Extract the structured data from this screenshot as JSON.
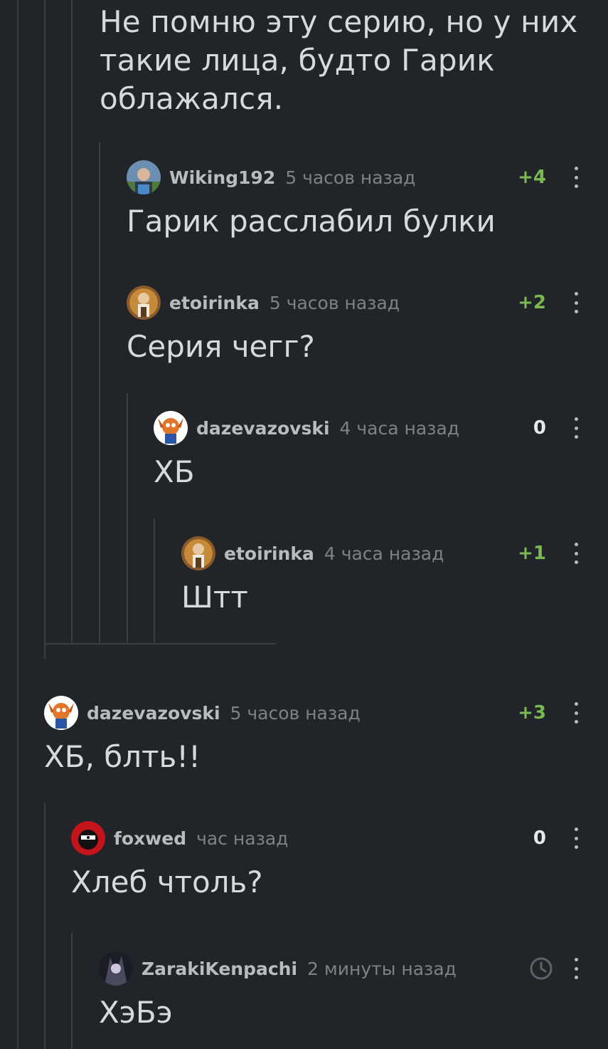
{
  "parent_comment_text": "Не помню эту серию, но у них такие лица, будто Гарик облажался.",
  "comments": [
    {
      "username": "Wiking192",
      "time": "5 часов назад",
      "rating": "+4",
      "text": "Гарик расслабил булки",
      "avatar": "wiking-avatar"
    },
    {
      "username": "etoirinka",
      "time": "5 часов назад",
      "rating": "+2",
      "text": "Серия чегг?",
      "avatar": "etoirinka-avatar"
    },
    {
      "username": "dazevazovski",
      "time": "4 часа назад",
      "rating": "0",
      "text": "ХБ",
      "avatar": "dazevazovski-avatar"
    },
    {
      "username": "etoirinka",
      "time": "4 часа назад",
      "rating": "+1",
      "text": "Штт",
      "avatar": "etoirinka-avatar"
    },
    {
      "username": "dazevazovski",
      "time": "5 часов назад",
      "rating": "+3",
      "text": "ХБ, блть!!",
      "avatar": "dazevazovski-avatar"
    },
    {
      "username": "foxwed",
      "time": "час назад",
      "rating": "0",
      "text": "Хлеб чтоль?",
      "avatar": "foxwed-avatar"
    },
    {
      "username": "ZarakiKenpachi",
      "time": "2 минуты назад",
      "rating": "",
      "text": "ХэБэ",
      "avatar": "zaraki-avatar",
      "status_icon": "clock-icon"
    }
  ],
  "colors": {
    "background": "#212529",
    "positive_rating": "#7ab94f",
    "thread_line": "#3a3f44"
  }
}
